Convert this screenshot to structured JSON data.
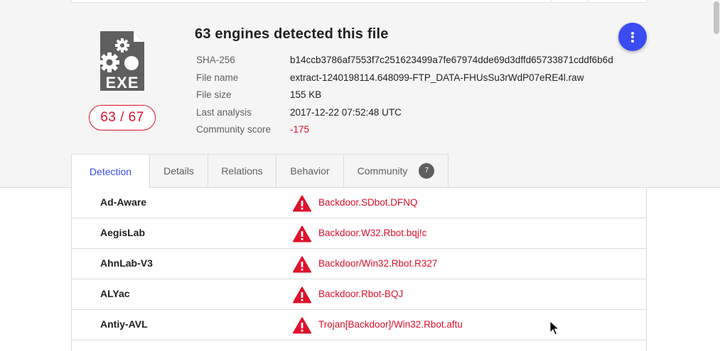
{
  "file": {
    "headline": "63 engines detected this file",
    "type_label": "EXE",
    "detection_ratio": "63 / 67",
    "details": [
      {
        "label": "SHA-256",
        "value": "b14ccb3786af7553f7c251623499a7fe67974dde69d3dffd65733871cddf6b6d"
      },
      {
        "label": "File name",
        "value": "extract-1240198114.648099-FTP_DATA-FHUsSu3rWdP07eRE4l.raw"
      },
      {
        "label": "File size",
        "value": "155 KB"
      },
      {
        "label": "Last analysis",
        "value": "2017-12-22 07:52:48 UTC"
      },
      {
        "label": "Community score",
        "value": "-175"
      }
    ]
  },
  "tabs": [
    {
      "label": "Detection",
      "active": true
    },
    {
      "label": "Details"
    },
    {
      "label": "Relations"
    },
    {
      "label": "Behavior"
    },
    {
      "label": "Community",
      "count": "7"
    }
  ],
  "detections": [
    {
      "engine": "Ad-Aware",
      "result": "Backdoor.SDbot.DFNQ"
    },
    {
      "engine": "AegisLab",
      "result": "Backdoor.W32.Rbot.bqj!c"
    },
    {
      "engine": "AhnLab-V3",
      "result": "Backdoor/Win32.Rbot.R327"
    },
    {
      "engine": "ALYac",
      "result": "Backdoor.Rbot-BQJ"
    },
    {
      "engine": "Antiy-AVL",
      "result": "Trojan[Backdoor]/Win32.Rbot.aftu"
    }
  ],
  "icons": {
    "file_type": "exe-file-icon",
    "more_actions": "more-vert-icon",
    "warning": "warning-triangle-icon",
    "cursor": "mouse-cursor-icon"
  },
  "colors": {
    "accent": "#3b4cf2",
    "malicious": "#e0112b",
    "icon_gray": "#5f5f5f",
    "header_bg": "#f5f5f5"
  }
}
